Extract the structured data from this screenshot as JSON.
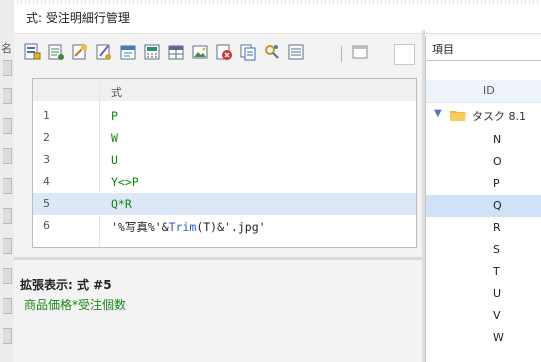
{
  "window": {
    "title": "式: 受注明細行管理"
  },
  "left_edge_char": "名",
  "toolbar": {
    "buttons": [
      {
        "name": "insert-field-icon",
        "color": "#4a6fb4"
      },
      {
        "name": "insert-table-icon",
        "color": "#3c8c3c"
      },
      {
        "name": "insert-function-icon",
        "color": "#b07820"
      },
      {
        "name": "insert-command-icon",
        "color": "#7a5cb0"
      },
      {
        "name": "insert-constant-icon",
        "color": "#3d7ec7"
      },
      {
        "name": "insert-calc-icon",
        "color": "#2f8f6f"
      },
      {
        "name": "insert-grid-icon",
        "color": "#5a6d8f"
      },
      {
        "name": "insert-image-icon",
        "color": "#4c8a3e"
      },
      {
        "name": "delete-row-icon",
        "color": "#d0342c"
      },
      {
        "name": "copy-row-icon",
        "color": "#2f6bbd"
      },
      {
        "name": "find-icon",
        "color": "#c49a1e"
      },
      {
        "name": "list-icon",
        "color": "#4f6a92"
      },
      {
        "name": "window-icon",
        "color": "#8a8a8a"
      }
    ]
  },
  "formula_list": {
    "header": "式",
    "rows": [
      {
        "num": "1",
        "formula": "P"
      },
      {
        "num": "2",
        "formula": "W"
      },
      {
        "num": "3",
        "formula": "U"
      },
      {
        "num": "4",
        "formula": "Y<>P"
      },
      {
        "num": "5",
        "formula": "Q*R",
        "selected": true
      },
      {
        "num": "6",
        "formula_parts": [
          "'%写真%'&",
          "Trim",
          "(T)&'.jpg'"
        ]
      }
    ]
  },
  "expanded": {
    "title": "拡張表示: 式 #5",
    "value": "商品価格*受注個数"
  },
  "right_pane": {
    "combo_label": "項目",
    "column_header": "ID",
    "tree_label": "タスク 8.1",
    "items": [
      "N",
      "O",
      "P",
      "Q",
      "R",
      "S",
      "T",
      "U",
      "V",
      "W"
    ],
    "selected_item": "Q"
  }
}
